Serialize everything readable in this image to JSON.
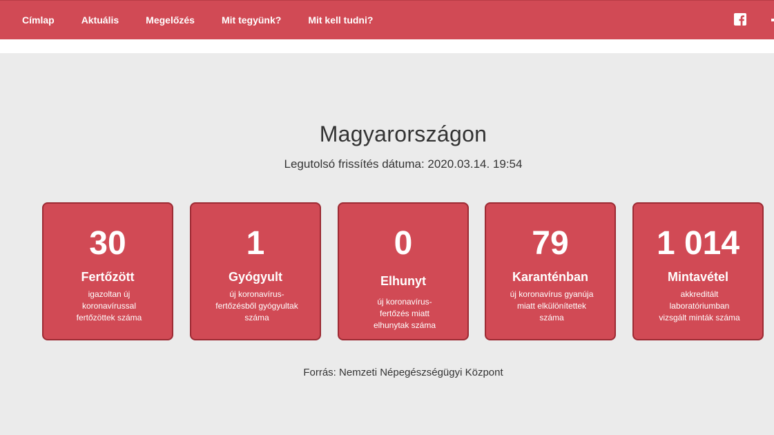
{
  "nav": {
    "items": [
      {
        "label": "Címlap"
      },
      {
        "label": "Aktuális"
      },
      {
        "label": "Megelőzés"
      },
      {
        "label": "Mit tegyünk?"
      },
      {
        "label": "Mit kell tudni?"
      }
    ],
    "social_icon": "facebook-icon"
  },
  "main": {
    "title": "Magyarországon",
    "updated": "Legutolsó frissítés dátuma: 2020.03.14. 19:54",
    "cards": [
      {
        "value": "30",
        "label": "Fertőzött",
        "desc": "igazoltan új koronavírussal fertőzöttek száma"
      },
      {
        "value": "1",
        "label": "Gyógyult",
        "desc": "új koronavírus-fertőzésből gyógyultak száma"
      },
      {
        "value": "0",
        "label": "Elhunyt",
        "desc": "új koronavírus-fertőzés miatt elhunytak száma"
      },
      {
        "value": "79",
        "label": "Karanténban",
        "desc": "új koronavírus gyanúja miatt elkülönítettek száma"
      },
      {
        "value": "1 014",
        "label": "Mintavétel",
        "desc": "akkreditált laboratóriumban vizsgált minták száma"
      }
    ],
    "source": "Forrás: Nemzeti Népegészségügyi Központ"
  },
  "colors": {
    "brand_red": "#d14a55",
    "card_border": "#9c2a33",
    "background": "#ebebeb"
  }
}
